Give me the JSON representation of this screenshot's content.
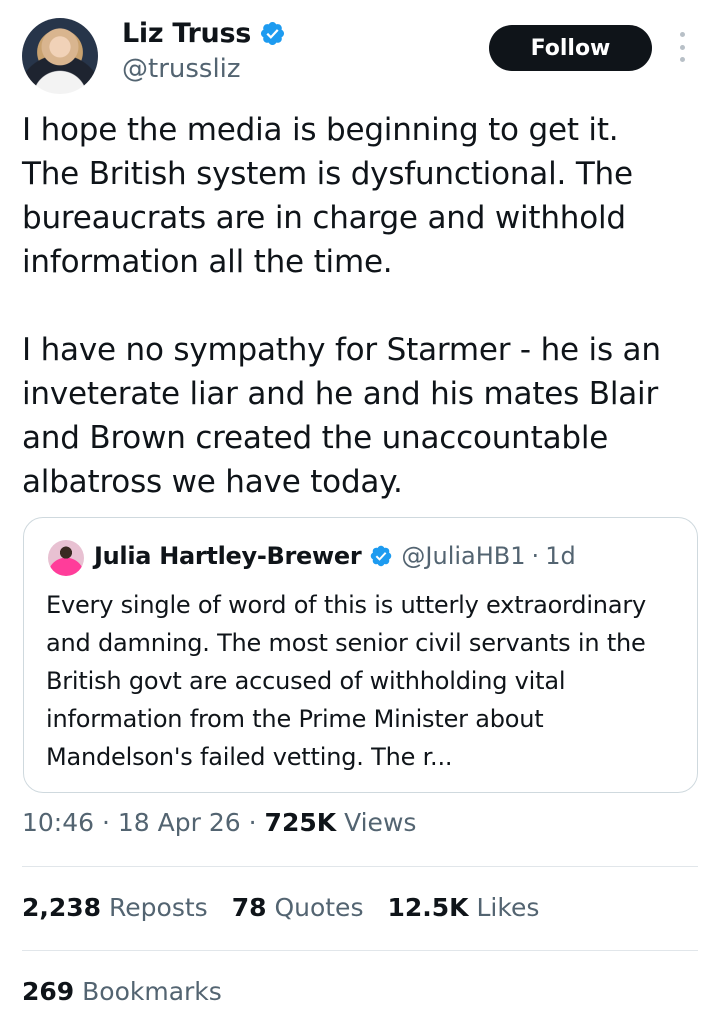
{
  "author": {
    "name": "Liz Truss",
    "handle": "@trussliz"
  },
  "follow_label": "Follow",
  "tweet_text": "I hope the media is beginning to get it.\nThe British system is dysfunctional. The\nbureaucrats are in charge and withhold\ninformation all the time.\n\nI have no sympathy for Starmer - he is an\ninveterate liar and he and his mates Blair\nand Brown created the unaccountable\nalbatross we have today.",
  "quote": {
    "name": "Julia Hartley-Brewer",
    "handle": "@JuliaHB1",
    "separator": "·",
    "time": "1d",
    "text": "Every single of word of this is utterly extraordinary and damning. The most senior civil servants in the British govt are accused of withholding vital information from the Prime Minister about Mandelson's failed vetting. The r..."
  },
  "meta": {
    "time": "10:46",
    "date": "18 Apr 26",
    "separator": "·",
    "views_count": "725K",
    "views_label": "Views"
  },
  "stats": {
    "reposts_count": "2,238",
    "reposts_label": "Reposts",
    "quotes_count": "78",
    "quotes_label": "Quotes",
    "likes_count": "12.5K",
    "likes_label": "Likes",
    "bookmarks_count": "269",
    "bookmarks_label": "Bookmarks"
  },
  "colors": {
    "verified": "#1d9bf0",
    "follow_button": "#0f1419",
    "secondary_text": "#536471"
  },
  "icons": {
    "verified": "verified-badge-icon",
    "more": "more-vertical-icon"
  }
}
